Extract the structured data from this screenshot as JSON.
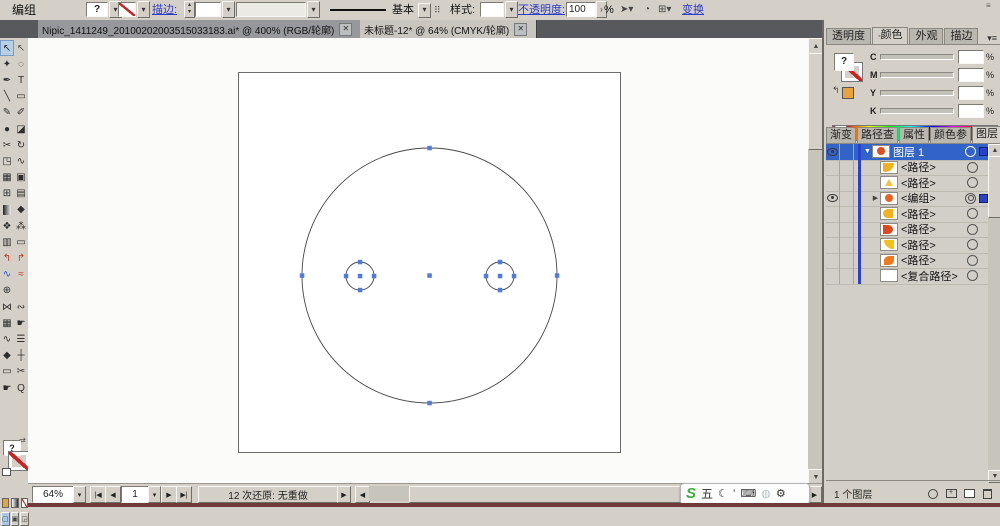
{
  "colors": {
    "chrome": "#d4d0c7",
    "selection_blue": "#3264c8",
    "layer_color_bar": "#2b41ce",
    "anchor_blue": "#4e7bdd",
    "link_blue": "#2b3cc8",
    "bottom_strip": "#6e3a3a",
    "ime_green": "#3cb035"
  },
  "control_bar": {
    "context": "编组",
    "fill_placeholder": "?",
    "stroke_label": "描边:",
    "brush_definition": "基本",
    "style_label": "样式:",
    "opacity_label": "不透明度:",
    "opacity_value": "100",
    "percent": "%",
    "transform": "变换"
  },
  "document_tabs": [
    {
      "title": "Nipic_1411249_20100202003515033183.ai* @ 400% (RGB/轮廓)",
      "active": false
    },
    {
      "title": "未标题-12* @ 64% (CMYK/轮廓)",
      "active": true
    }
  ],
  "tools": [
    {
      "name": "selection-tool",
      "glyph": "↖",
      "active": true
    },
    {
      "name": "direct-selection-tool",
      "glyph": "↖",
      "color": "#5a5a5a"
    },
    {
      "name": "magic-wand-tool",
      "glyph": "✦"
    },
    {
      "name": "lasso-tool",
      "glyph": "◌"
    },
    {
      "name": "pen-tool",
      "glyph": "✒"
    },
    {
      "name": "type-tool",
      "glyph": "T"
    },
    {
      "name": "line-segment-tool",
      "glyph": "╲"
    },
    {
      "name": "rectangle-tool",
      "glyph": "▭"
    },
    {
      "name": "paintbrush-tool",
      "glyph": "✎"
    },
    {
      "name": "pencil-tool",
      "glyph": "✐"
    },
    {
      "name": "blob-brush-tool",
      "glyph": "●"
    },
    {
      "name": "eraser-tool",
      "glyph": "◪"
    },
    {
      "name": "scissors-tool",
      "glyph": "✂"
    },
    {
      "name": "rotate-tool",
      "glyph": "↻"
    },
    {
      "name": "scale-tool",
      "glyph": "◳"
    },
    {
      "name": "width-tool",
      "glyph": "∿"
    },
    {
      "name": "free-transform-tool",
      "glyph": "▦"
    },
    {
      "name": "shape-builder-tool",
      "glyph": "▣"
    },
    {
      "name": "perspective-grid-tool",
      "glyph": "⊞"
    },
    {
      "name": "mesh-tool",
      "glyph": "▤"
    },
    {
      "name": "gradient-tool",
      "glyph": "▩"
    },
    {
      "name": "eyedropper-tool",
      "glyph": "◆"
    },
    {
      "name": "blend-tool",
      "glyph": "❖"
    },
    {
      "name": "symbol-sprayer-tool",
      "glyph": "⁂"
    },
    {
      "name": "column-graph-tool",
      "glyph": "▥"
    },
    {
      "name": "artboard-tool",
      "glyph": "▭"
    },
    {
      "name": "live-paint-bucket-tool",
      "glyph": "↰",
      "color": "#c03226"
    },
    {
      "name": "live-paint-selection-tool",
      "glyph": "↱",
      "color": "#c03226"
    },
    {
      "name": "path-eraser-tool",
      "glyph": "∿",
      "color": "#2b4fd6"
    },
    {
      "name": "smooth-tool",
      "glyph": "≈",
      "color": "#c03226"
    },
    {
      "name": "rotate-view-tool",
      "glyph": "⊕"
    },
    {
      "name": "print-tiling-tool",
      "glyph": ""
    },
    {
      "name": "warp-tool",
      "glyph": "⋈"
    },
    {
      "name": "pucker-tool",
      "glyph": "∾"
    },
    {
      "name": "grid-tool",
      "glyph": "▦"
    },
    {
      "name": "puppet-warp-tool",
      "glyph": "☛"
    },
    {
      "name": "wrinkle-tool",
      "glyph": "∿"
    },
    {
      "name": "crystallize-tool",
      "glyph": "☰"
    },
    {
      "name": "measure-eyedropper-tool",
      "glyph": "◆"
    },
    {
      "name": "measure-tool",
      "glyph": "┼"
    },
    {
      "name": "artboard-alt-tool",
      "glyph": "▭"
    },
    {
      "name": "slice-tool",
      "glyph": "✂"
    },
    {
      "name": "hand-tool",
      "glyph": "☛"
    },
    {
      "name": "zoom-tool",
      "glyph": "Q"
    }
  ],
  "color_panel": {
    "tabs": [
      "透明度",
      "颜色",
      "外观",
      "描边"
    ],
    "active_tab": "颜色",
    "fill_placeholder": "?",
    "channels": [
      "C",
      "M",
      "Y",
      "K"
    ],
    "percent": "%"
  },
  "layers_panel": {
    "tabs": [
      "渐变",
      "路径查",
      "属性",
      "颜色参",
      "图层"
    ],
    "active_tab": "图层",
    "rows": [
      {
        "name": "图层 1",
        "selected": true,
        "eye": true,
        "disclosure": "open",
        "indent": 0,
        "thumb": "red-circle",
        "target": "ring",
        "proxy": true
      },
      {
        "name": "<路径>",
        "eye": false,
        "indent": 1,
        "thumb": "yellow-arc",
        "target": "ring"
      },
      {
        "name": "<路径>",
        "eye": false,
        "indent": 1,
        "thumb": "yellow-tri",
        "target": "ring"
      },
      {
        "name": "<编组>",
        "eye": true,
        "disclosure": "closed",
        "indent": 1,
        "thumb": "orange-circle",
        "target": "ring-selected",
        "proxy": true
      },
      {
        "name": "<路径>",
        "eye": false,
        "indent": 1,
        "thumb": "yellow-blob",
        "target": "ring"
      },
      {
        "name": "<路径>",
        "eye": false,
        "indent": 1,
        "thumb": "red-wedge",
        "target": "ring"
      },
      {
        "name": "<路径>",
        "eye": false,
        "indent": 1,
        "thumb": "yellow-wedge",
        "target": "ring"
      },
      {
        "name": "<路径>",
        "eye": false,
        "indent": 1,
        "thumb": "orange-wedge",
        "target": "ring"
      },
      {
        "name": "<复合路径>",
        "eye": false,
        "indent": 1,
        "thumb": "white",
        "target": "ring"
      }
    ],
    "footer_count": "1 个图层"
  },
  "status_bar": {
    "zoom": "64%",
    "artboard_number": "1",
    "history": "12 次还原: 无重做"
  },
  "ime": {
    "logo": "S",
    "mode": "五"
  }
}
